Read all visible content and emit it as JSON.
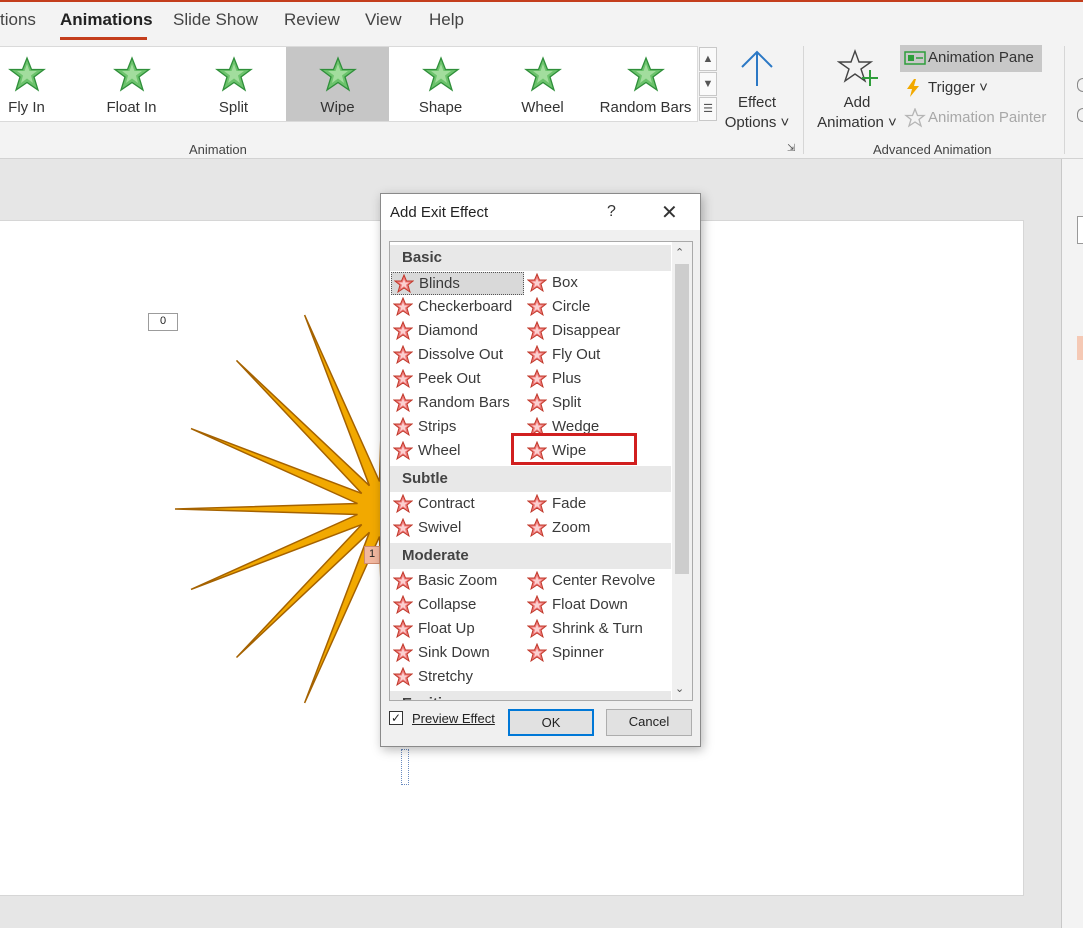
{
  "tabs": [
    "tions",
    "Animations",
    "Slide Show",
    "Review",
    "View",
    "Help"
  ],
  "active_tab": "Animations",
  "animation_gallery": {
    "items": [
      "Fly In",
      "Float In",
      "Split",
      "Wipe",
      "Shape",
      "Wheel",
      "Random Bars"
    ],
    "selected": "Wipe",
    "group_label": "Animation"
  },
  "effect_options": {
    "line1": "Effect",
    "line2": "Options ˅"
  },
  "add_animation": {
    "line1": "Add",
    "line2": "Animation ˅"
  },
  "advanced": {
    "animation_pane": "Animation Pane",
    "trigger": "Trigger ˅",
    "animation_painter": "Animation Painter",
    "group_label": "Advanced Animation"
  },
  "slide": {
    "tag_top": "0",
    "tag_mid": "1"
  },
  "dialog": {
    "title": "Add Exit Effect",
    "help": "?",
    "close": "✕",
    "categories": [
      "Basic",
      "Subtle",
      "Moderate",
      "Exciting"
    ],
    "basic_left": [
      "Blinds",
      "Checkerboard",
      "Diamond",
      "Dissolve Out",
      "Peek Out",
      "Random Bars",
      "Strips",
      "Wheel"
    ],
    "basic_right": [
      "Box",
      "Circle",
      "Disappear",
      "Fly Out",
      "Plus",
      "Split",
      "Wedge",
      "Wipe"
    ],
    "subtle_left": [
      "Contract",
      "Swivel"
    ],
    "subtle_right": [
      "Fade",
      "Zoom"
    ],
    "moderate_left": [
      "Basic Zoom",
      "Collapse",
      "Float Up",
      "Sink Down",
      "Stretchy"
    ],
    "moderate_right": [
      "Center Revolve",
      "Float Down",
      "Shrink & Turn",
      "Spinner"
    ],
    "selected_effect": "Blinds",
    "preview_label": "Preview Effect",
    "preview_checked": true,
    "ok_label": "OK",
    "cancel_label": "Cancel"
  },
  "colors": {
    "accent": "#c43e1c",
    "highlight_box": "#d11f1f",
    "ok_border": "#0078d7",
    "star_gold": "#f2a900",
    "star_green": "#4caf50",
    "effect_red": "#e04040"
  },
  "icons": [
    "green-star-icon",
    "arrow-up-icon",
    "add-star-icon",
    "animation-pane-icon",
    "lightning-icon",
    "painter-star-icon",
    "red-star-icon",
    "checkbox-icon",
    "close-icon",
    "help-icon"
  ]
}
